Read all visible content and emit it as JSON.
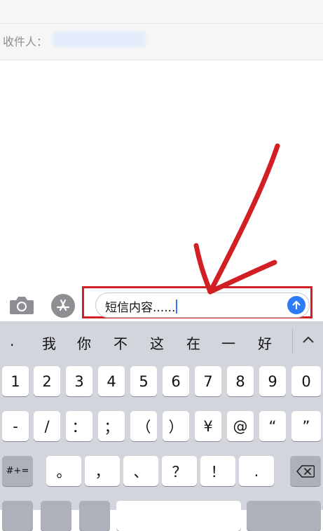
{
  "recipient": {
    "label": "收件人：",
    "value": ""
  },
  "compose": {
    "message_text": "短信内容......",
    "camera_icon": "camera-icon",
    "appstore_icon": "app-store-icon",
    "send_icon": "arrow-up-icon"
  },
  "annotation": {
    "color": "#d11f23",
    "arrow": "red-arrow-pointing-to-input"
  },
  "keyboard": {
    "candidates": [
      ".",
      "我",
      "你",
      "不",
      "这",
      "在",
      "一",
      "好"
    ],
    "expand_icon": "chevron-up-icon",
    "row1": [
      "1",
      "2",
      "3",
      "4",
      "5",
      "6",
      "7",
      "8",
      "9",
      "0"
    ],
    "row2": [
      "-",
      "/",
      "：",
      "；",
      "（",
      "）",
      "¥",
      "@",
      "“",
      "”"
    ],
    "row3_left": "#+=",
    "row3": [
      "。",
      "，",
      "、",
      "？",
      "！",
      "."
    ],
    "row3_right_icon": "backspace-icon"
  },
  "colors": {
    "accent": "#2d7cf6",
    "keyboard_bg": "#d2d5db",
    "annotation": "#d11f23"
  }
}
